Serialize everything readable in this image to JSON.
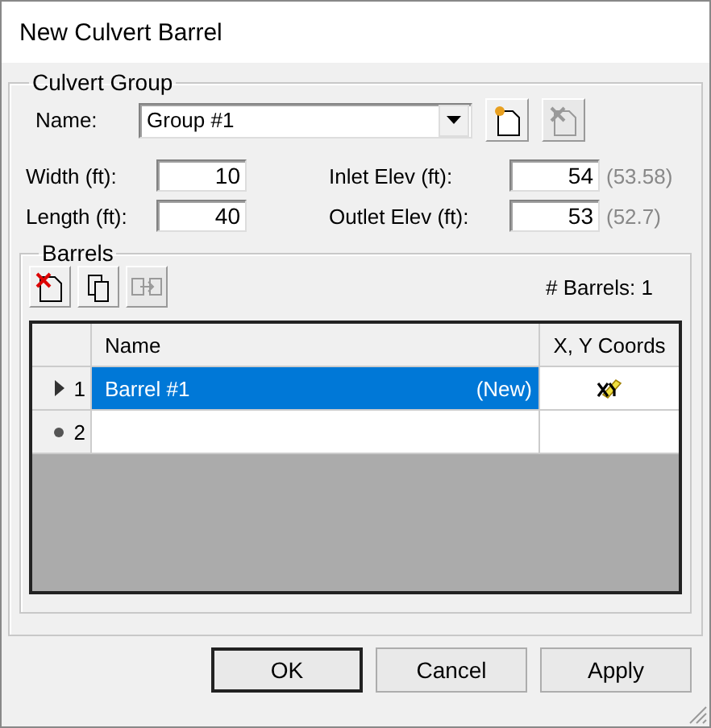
{
  "window": {
    "title": "New Culvert Barrel"
  },
  "culvert_group": {
    "legend": "Culvert Group",
    "name_label": "Name:",
    "name_value": "Group #1",
    "tools": [
      {
        "kind": "new",
        "disabled": false
      },
      {
        "kind": "delete",
        "disabled": true
      }
    ],
    "fields_left": [
      {
        "label": "Width (ft):",
        "value": "10"
      },
      {
        "label": "Length (ft):",
        "value": "40"
      }
    ],
    "fields_right": [
      {
        "label": "Inlet Elev (ft):",
        "value": "54",
        "hint": "(53.58)"
      },
      {
        "label": "Outlet Elev (ft):",
        "value": "53",
        "hint": "(52.7)"
      }
    ]
  },
  "barrels": {
    "legend": "Barrels",
    "count": "# Barrels: 1",
    "tools": [
      {
        "kind": "delete",
        "disabled": false
      },
      {
        "kind": "copy",
        "disabled": false
      },
      {
        "kind": "move",
        "disabled": true
      }
    ],
    "columns": [
      "Name",
      "X, Y Coords"
    ],
    "rows": [
      {
        "kind": "current",
        "number": "1",
        "name": "Barrel #1",
        "status": "(New)",
        "coords_icon": true,
        "selected": true
      },
      {
        "kind": "new",
        "number": "2",
        "selected": false
      }
    ]
  },
  "buttons": [
    {
      "label": "OK",
      "default": true
    },
    {
      "label": "Cancel",
      "default": false
    },
    {
      "label": "Apply",
      "default": false
    }
  ]
}
